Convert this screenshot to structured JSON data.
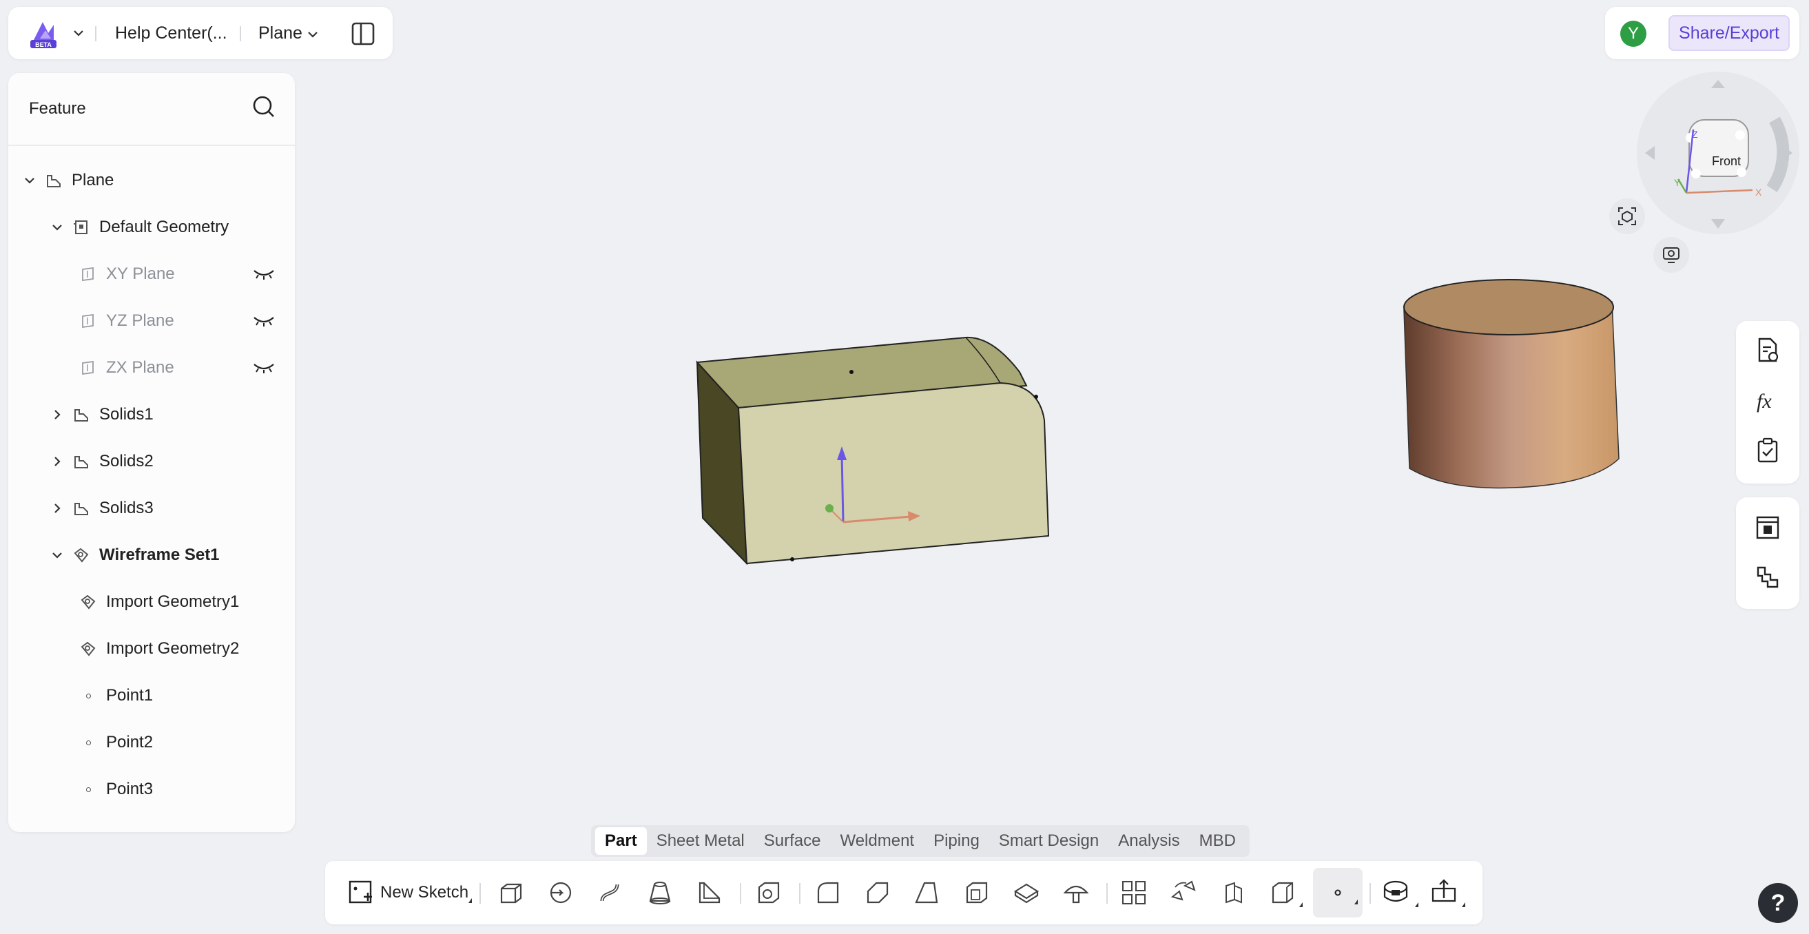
{
  "topbar": {
    "logo_badge": "BETA",
    "crumb_doc": "Help Center(...",
    "crumb_part": "Plane"
  },
  "topright": {
    "avatar_letter": "Y",
    "share_label": "Share/Export"
  },
  "feature": {
    "title": "Feature",
    "tree": [
      {
        "label": "Plane",
        "icon": "part-icon"
      },
      {
        "label": "Default Geometry",
        "icon": "default-geometry-icon"
      },
      {
        "label": "XY Plane",
        "icon": "plane-icon",
        "hidden": true
      },
      {
        "label": "YZ Plane",
        "icon": "plane-icon",
        "hidden": true
      },
      {
        "label": "ZX Plane",
        "icon": "plane-icon",
        "hidden": true
      },
      {
        "label": "Solids1",
        "icon": "solid-icon"
      },
      {
        "label": "Solids2",
        "icon": "solid-icon"
      },
      {
        "label": "Solids3",
        "icon": "solid-icon"
      },
      {
        "label": "Wireframe Set1",
        "icon": "wireframe-icon"
      },
      {
        "label": "Import Geometry1",
        "icon": "import-geometry-icon"
      },
      {
        "label": "Import Geometry2",
        "icon": "import-geometry-icon"
      },
      {
        "label": "Point1",
        "icon": "point-icon"
      },
      {
        "label": "Point2",
        "icon": "point-icon"
      },
      {
        "label": "Point3",
        "icon": "point-icon"
      }
    ]
  },
  "navcube": {
    "face_label": "Front",
    "axis_x": "X",
    "axis_y": "Y",
    "axis_z": "Z"
  },
  "tabs": [
    {
      "label": "Part",
      "active": true
    },
    {
      "label": "Sheet Metal"
    },
    {
      "label": "Surface"
    },
    {
      "label": "Weldment"
    },
    {
      "label": "Piping"
    },
    {
      "label": "Smart Design"
    },
    {
      "label": "Analysis"
    },
    {
      "label": "MBD"
    }
  ],
  "toolbar": {
    "new_sketch_label": "New Sketch"
  },
  "help": {
    "label": "?"
  },
  "colors": {
    "accent": "#5a3fd6",
    "box_front": "#d3d2ad",
    "box_top": "#a8a776",
    "box_side": "#4a4724",
    "cylinder_top": "#b08a63"
  }
}
